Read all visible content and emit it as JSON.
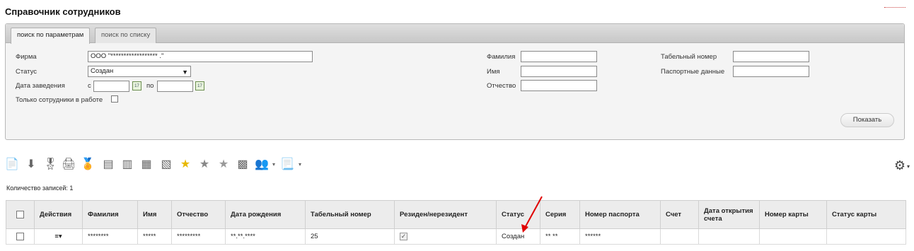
{
  "page": {
    "title": "Справочник сотрудников"
  },
  "tabs": [
    {
      "label": "поиск по параметрам",
      "active": true
    },
    {
      "label": "поиск по списку",
      "active": false
    }
  ],
  "filters": {
    "firm": {
      "label": "Фирма",
      "value": "ООО \"****************** .\""
    },
    "status": {
      "label": "Статус",
      "value": "Создан"
    },
    "created": {
      "label": "Дата заведения",
      "from_label": "с",
      "to_label": "по",
      "from_value": "",
      "to_value": ""
    },
    "only_working": {
      "label": "Только сотрудники в работе",
      "checked": false
    },
    "lastname": {
      "label": "Фамилия",
      "value": ""
    },
    "firstname": {
      "label": "Имя",
      "value": ""
    },
    "patronymic": {
      "label": "Отчество",
      "value": ""
    },
    "tabnum": {
      "label": "Табельный номер",
      "value": ""
    },
    "passport": {
      "label": "Паспортные данные",
      "value": ""
    },
    "show_button": "Показать"
  },
  "toolbar": {
    "icons": [
      "new-document-icon",
      "download-icon",
      "award-icon",
      "print-icon",
      "award-check-icon",
      "card-icon",
      "card-alt-icon",
      "card-edit-icon",
      "card-stack-icon",
      "star-icon",
      "star-gray-icon",
      "star-gray-alt-icon",
      "card-list-icon",
      "users-icon",
      "document-menu-icon"
    ]
  },
  "records_count": "Количество записей: 1",
  "table": {
    "columns": [
      "Действия",
      "Фамилия",
      "Имя",
      "Отчество",
      "Дата рождения",
      "Табельный номер",
      "Резиден/нерезидент",
      "Статус",
      "Серия",
      "Номер паспорта",
      "Счет",
      "Дата открытия счета",
      "Номер карты",
      "Статус карты"
    ],
    "rows": [
      {
        "lastname": "********",
        "firstname": "*****",
        "patronymic": "*********",
        "birthdate": "**.**.****",
        "tabnum": "25",
        "resident": true,
        "status": "Создан",
        "series": "** **",
        "passport_no": "******",
        "account": "",
        "open_date": "",
        "card_no": "",
        "card_status": ""
      }
    ]
  },
  "colors": {
    "annotation_arrow": "#e00000",
    "header_bg": "#ececec",
    "panel_bg": "#f4f4f4"
  }
}
